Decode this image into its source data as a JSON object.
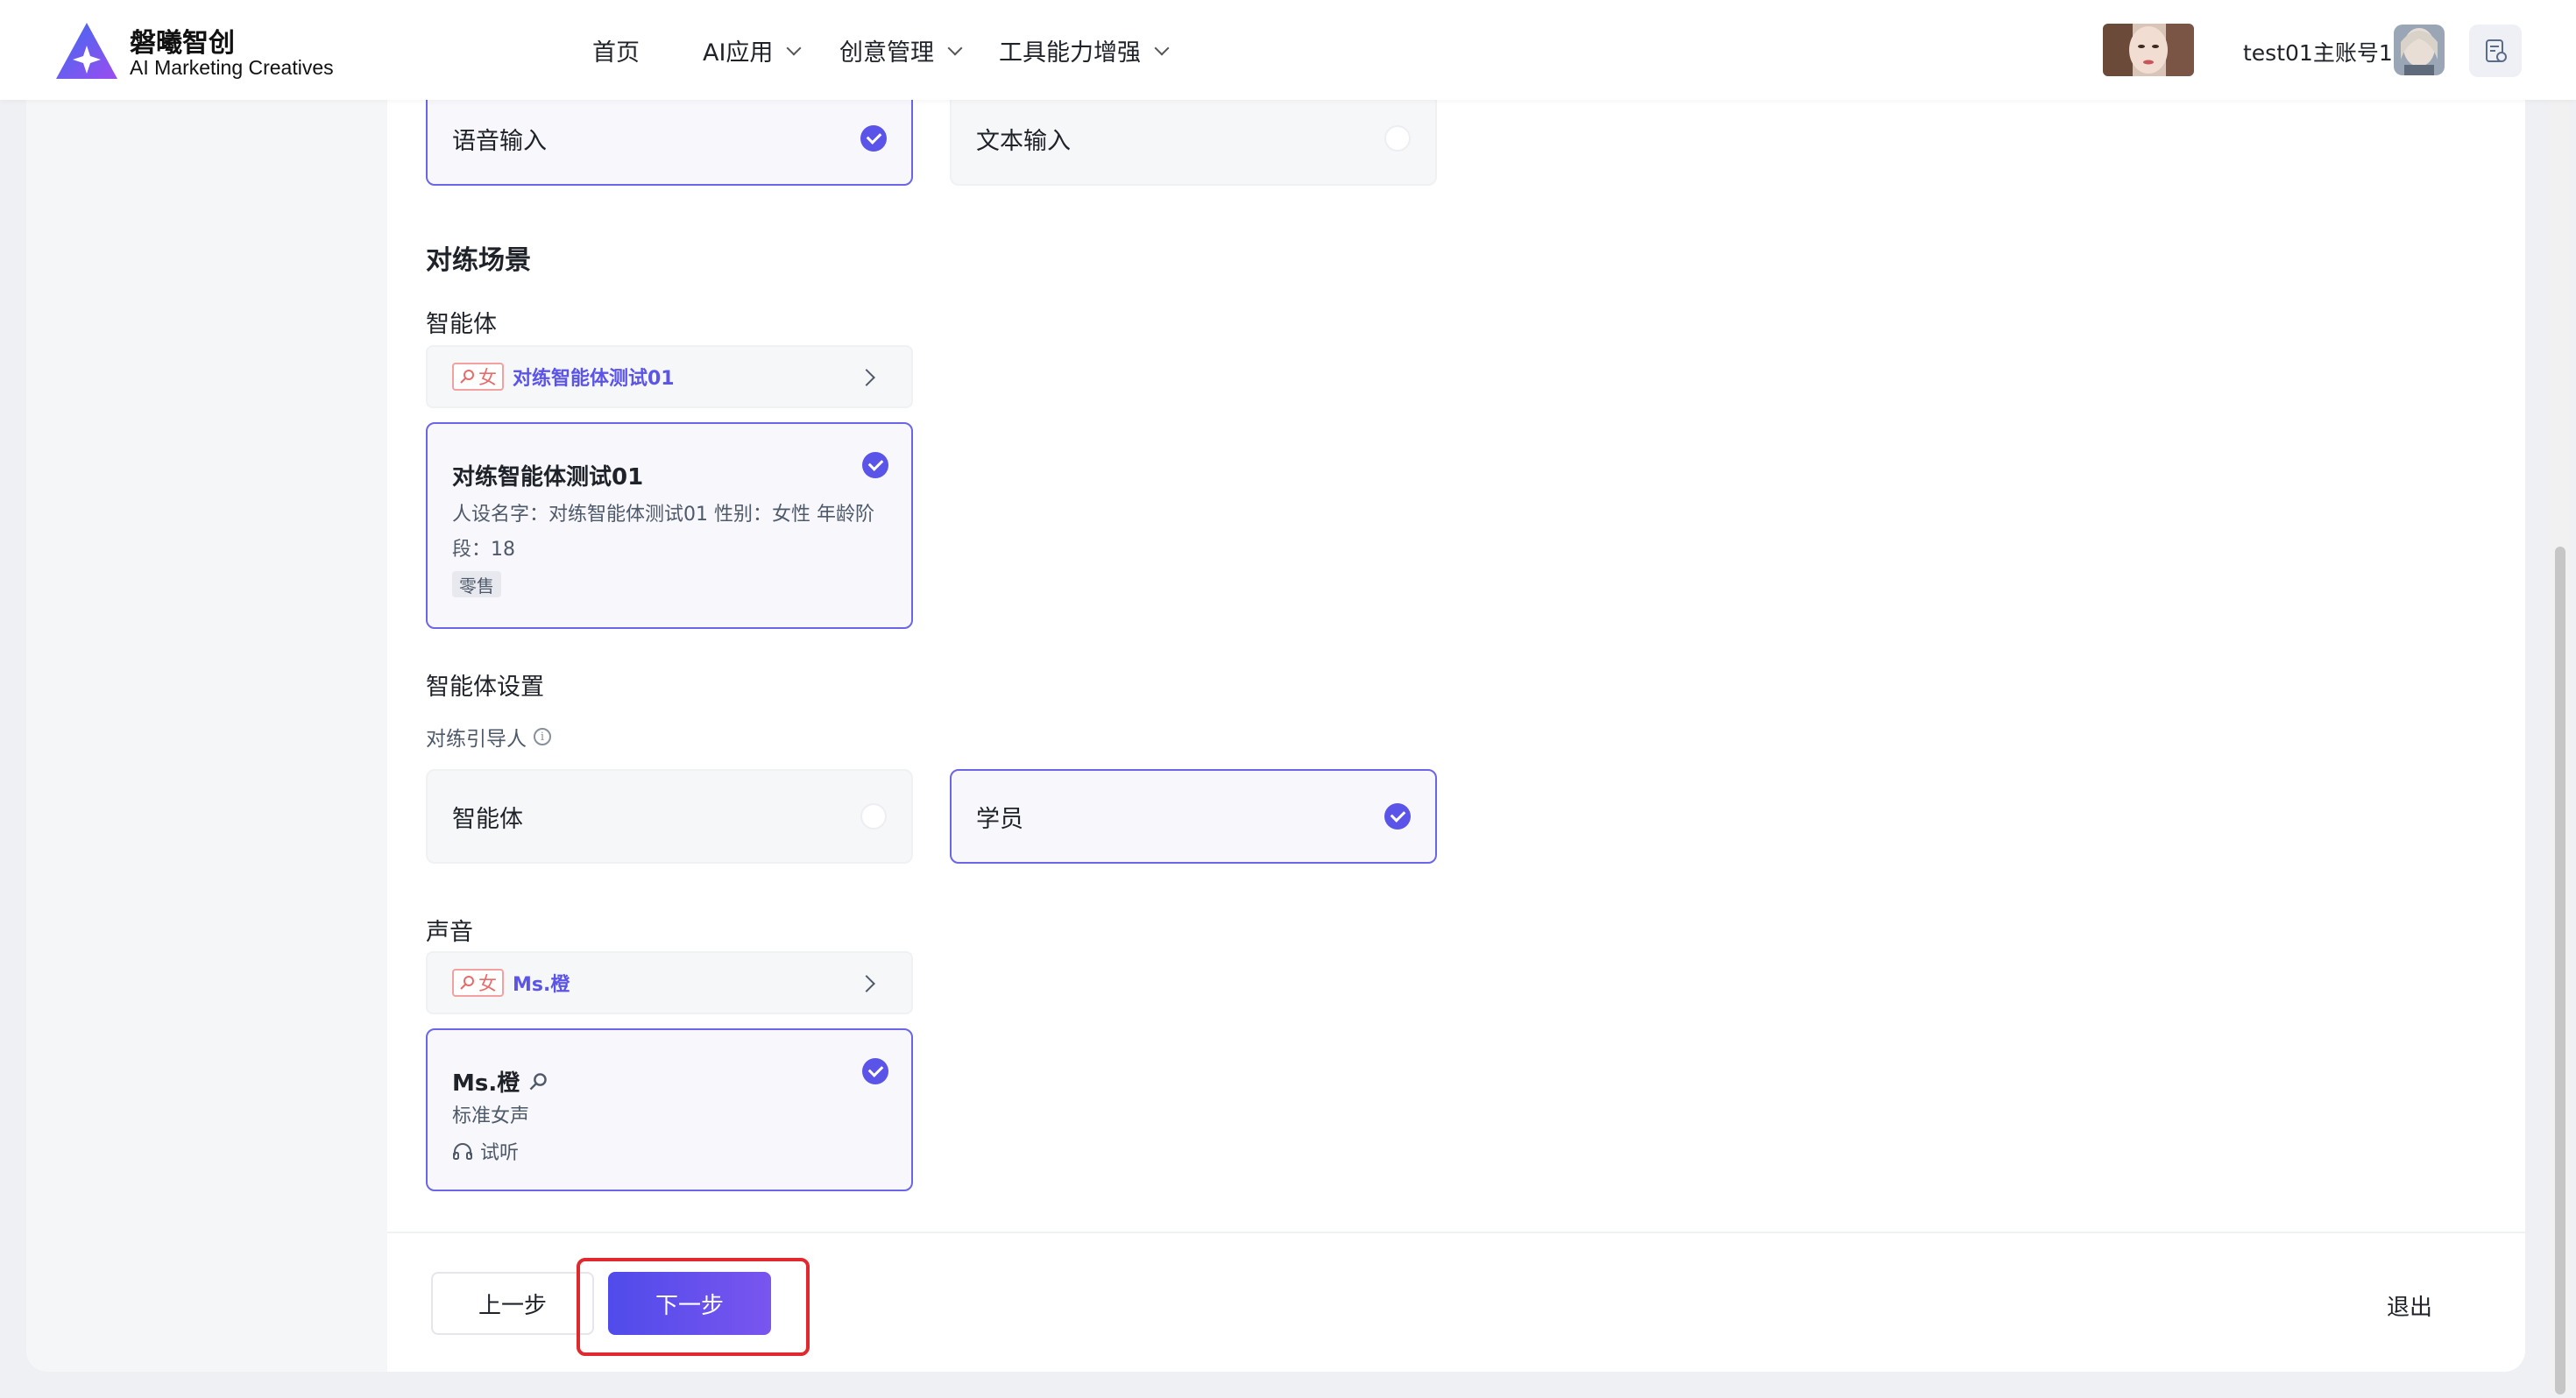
{
  "brand": {
    "name": "磐曦智创",
    "subtitle": "AI Marketing Creatives"
  },
  "nav": [
    {
      "label": "首页",
      "has_dropdown": false
    },
    {
      "label": "AI应用",
      "has_dropdown": true
    },
    {
      "label": "创意管理",
      "has_dropdown": true
    },
    {
      "label": "工具能力增强",
      "has_dropdown": true
    }
  ],
  "user": {
    "name": "test01主账号1"
  },
  "input_mode": {
    "options": [
      {
        "label": "语音输入",
        "selected": true
      },
      {
        "label": "文本输入",
        "selected": false
      }
    ]
  },
  "scene": {
    "title": "对练场景",
    "agent_label": "智能体",
    "agent_selector": {
      "gender": "女",
      "name": "对练智能体测试01"
    },
    "agent_card": {
      "title": "对练智能体测试01",
      "desc": "人设名字：对练智能体测试01 性别：女性 年龄阶段：18",
      "tag": "零售",
      "selected": true
    }
  },
  "agent_settings": {
    "title": "智能体设置",
    "guide_label": "对练引导人",
    "guide_options": [
      {
        "label": "智能体",
        "selected": false
      },
      {
        "label": "学员",
        "selected": true
      }
    ]
  },
  "voice": {
    "label": "声音",
    "selector": {
      "gender": "女",
      "name": "Ms.橙"
    },
    "card": {
      "title": "Ms.橙",
      "desc": "标准女声",
      "listen_label": "试听",
      "selected": true
    }
  },
  "footer": {
    "prev_label": "上一步",
    "next_label": "下一步",
    "exit_label": "退出"
  },
  "colors": {
    "accent": "#5b54e8",
    "highlight": "#e0282e",
    "female_tag": "#e86b6b"
  }
}
